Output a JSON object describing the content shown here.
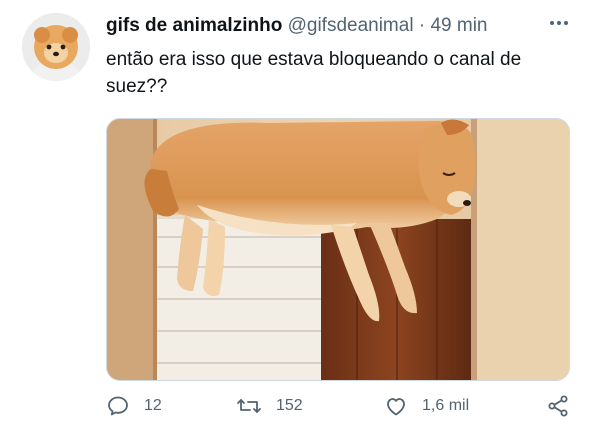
{
  "tweet": {
    "author_name": "gifs de animalzinho",
    "author_handle": "@gifsdeanimal",
    "separator": "·",
    "time": "49 min",
    "text": "então era isso que estava bloqueando o canal de suez??"
  },
  "actions": {
    "replies": "12",
    "retweets": "152",
    "likes": "1,6 mil"
  },
  "icons": [
    "avatar-pomeranian",
    "more-icon",
    "reply-icon",
    "retweet-icon",
    "like-icon",
    "share-icon"
  ],
  "colors": {
    "text": "#0f1419",
    "secondary": "#536471"
  }
}
